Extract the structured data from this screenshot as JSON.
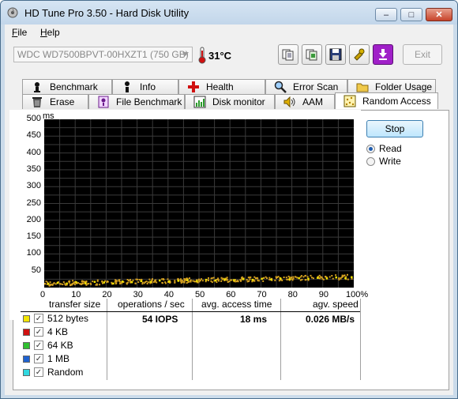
{
  "window": {
    "title": "HD Tune Pro 3.50 - Hard Disk Utility",
    "minimize": "–",
    "maximize": "□",
    "close": "✕"
  },
  "menu": {
    "file_key": "F",
    "file_rest": "ile",
    "help_key": "H",
    "help_rest": "elp"
  },
  "toolbar": {
    "drive": "WDC WD7500BPVT-00HXZT1 (750 GB)",
    "temperature": "31°C",
    "exit_label": "Exit",
    "buttons": [
      "copy-text-icon",
      "copy-screenshot-icon",
      "save-icon",
      "options-icon",
      "download-icon"
    ]
  },
  "tabs_top": [
    {
      "label": "Benchmark",
      "icon": "benchmark-icon"
    },
    {
      "label": "Info",
      "icon": "info-icon"
    },
    {
      "label": "Health",
      "icon": "health-icon"
    },
    {
      "label": "Error Scan",
      "icon": "magnifier-icon"
    },
    {
      "label": "Folder Usage",
      "icon": "folder-icon"
    }
  ],
  "tabs_bottom": [
    {
      "label": "Erase",
      "icon": "trash-icon"
    },
    {
      "label": "File Benchmark",
      "icon": "file-benchmark-icon"
    },
    {
      "label": "Disk monitor",
      "icon": "disk-monitor-icon"
    },
    {
      "label": "AAM",
      "icon": "speaker-icon"
    },
    {
      "label": "Random Access",
      "icon": "random-access-icon",
      "active": true
    }
  ],
  "controls": {
    "stop_label": "Stop",
    "read_label": "Read",
    "write_label": "Write",
    "mode": "read"
  },
  "chart_data": {
    "type": "scatter",
    "y_unit": "ms",
    "ylim": [
      0,
      500
    ],
    "yticks": [
      "500",
      "450",
      "400",
      "350",
      "300",
      "250",
      "200",
      "150",
      "100",
      "50"
    ],
    "xlim": [
      0,
      100
    ],
    "xticks": [
      "0",
      "10",
      "20",
      "30",
      "40",
      "50",
      "60",
      "70",
      "80",
      "90",
      "100%"
    ],
    "grid": true,
    "background": "#000000",
    "series": [
      {
        "name": "512 bytes",
        "color": "#f2e400",
        "points": [
          [
            1,
            14
          ],
          [
            4,
            17
          ],
          [
            7,
            15
          ],
          [
            10,
            19
          ],
          [
            13,
            16
          ],
          [
            16,
            20
          ],
          [
            19,
            18
          ],
          [
            22,
            15
          ],
          [
            25,
            21
          ],
          [
            28,
            19
          ],
          [
            31,
            22
          ],
          [
            34,
            20
          ],
          [
            37,
            24
          ],
          [
            40,
            21
          ],
          [
            43,
            23
          ],
          [
            46,
            25
          ],
          [
            49,
            22
          ],
          [
            52,
            26
          ],
          [
            55,
            24
          ],
          [
            58,
            27
          ],
          [
            61,
            25
          ],
          [
            64,
            28
          ],
          [
            67,
            26
          ],
          [
            70,
            29
          ],
          [
            73,
            27
          ],
          [
            76,
            30
          ],
          [
            79,
            28
          ],
          [
            82,
            31
          ],
          [
            85,
            29
          ],
          [
            88,
            32
          ],
          [
            91,
            30
          ],
          [
            94,
            33
          ],
          [
            97,
            31
          ],
          [
            99,
            34
          ]
        ]
      }
    ],
    "noise_color": "#d4a020"
  },
  "results": {
    "headers": {
      "size": "transfer size",
      "ops": "operations / sec",
      "access": "avg. access time",
      "speed": "agv. speed"
    },
    "rows": [
      {
        "label": "512 bytes",
        "color": "#f2e400",
        "checked": true,
        "ops": "54 IOPS",
        "access": "18 ms",
        "speed": "0.026 MB/s"
      },
      {
        "label": "4 KB",
        "color": "#d01010",
        "checked": true
      },
      {
        "label": "64 KB",
        "color": "#30c030",
        "checked": true
      },
      {
        "label": "1 MB",
        "color": "#1f62d0",
        "checked": true
      },
      {
        "label": "Random",
        "color": "#30d8e0",
        "checked": true
      }
    ],
    "check_mark": "✓"
  }
}
